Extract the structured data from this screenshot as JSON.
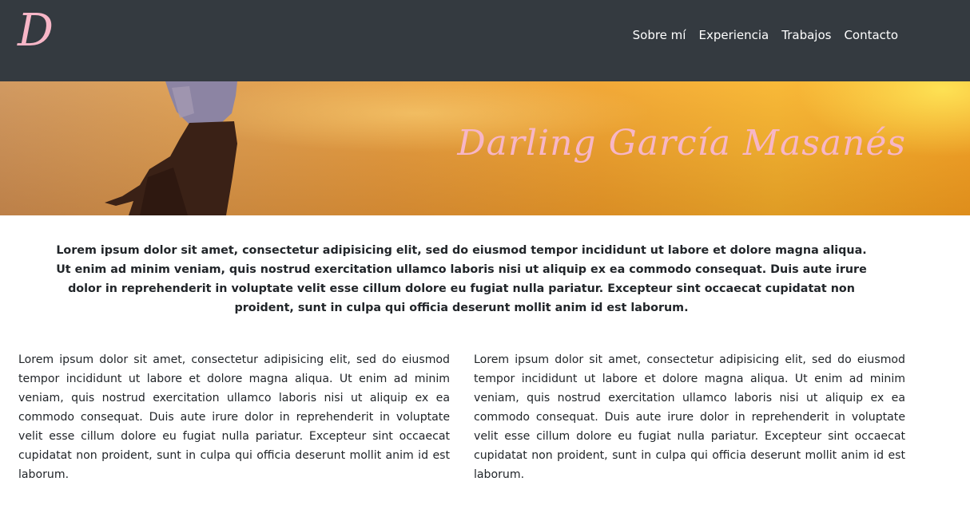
{
  "navbar": {
    "logo_text": "D",
    "links": [
      "Sobre mí",
      "Experiencia",
      "Trabajos",
      "Contacto"
    ]
  },
  "hero": {
    "title": "Darling García Masanés"
  },
  "intro": {
    "text": "Lorem ipsum dolor sit amet, consectetur adipisicing elit, sed do eiusmod tempor incididunt ut labore et dolore magna aliqua. Ut enim ad minim veniam, quis nostrud exercitation ullamco laboris nisi ut aliquip ex ea commodo consequat. Duis aute irure dolor in reprehenderit in voluptate velit esse cillum dolore eu fugiat nulla pariatur. Excepteur sint occaecat cupidatat non proident, sunt in culpa qui officia deserunt mollit anim id est laborum."
  },
  "columns": [
    "Lorem ipsum dolor sit amet, consectetur adipisicing elit, sed do eiusmod tempor incididunt ut labore et dolore magna aliqua. Ut enim ad minim veniam, quis nostrud exercitation ullamco laboris nisi ut aliquip ex ea commodo consequat. Duis aute irure dolor in reprehenderit in voluptate velit esse cillum dolore eu fugiat nulla pariatur. Excepteur sint occaecat cupidatat non proident, sunt in culpa qui officia deserunt mollit anim id est laborum.",
    "Lorem ipsum dolor sit amet, consectetur adipisicing elit, sed do eiusmod tempor incididunt ut labore et dolore magna aliqua. Ut enim ad minim veniam, quis nostrud exercitation ullamco laboris nisi ut aliquip ex ea commodo consequat. Duis aute irure dolor in reprehenderit in voluptate velit esse cillum dolore eu fugiat nulla pariatur. Excepteur sint occaecat cupidatat non proident, sunt in culpa qui officia deserunt mollit anim id est laborum."
  ],
  "colors": {
    "navbar_bg": "#343a40",
    "accent_pink": "#f7b6c7",
    "nav_text": "#ffffff",
    "body_text": "#212529"
  }
}
